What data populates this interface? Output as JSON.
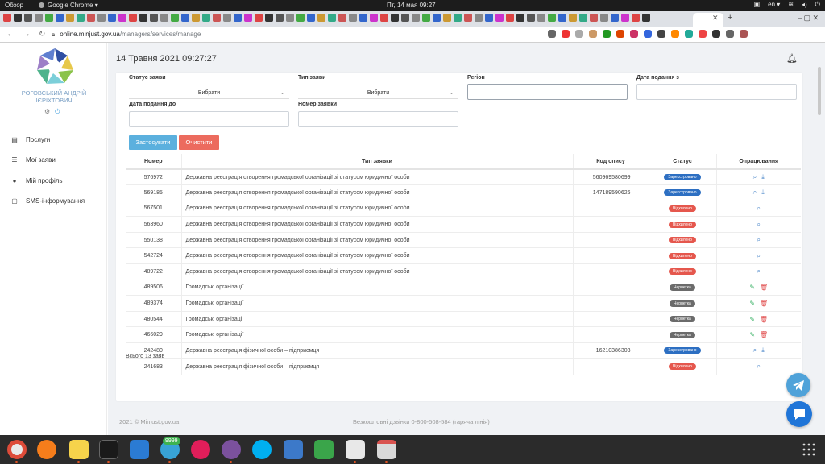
{
  "os_bar": {
    "overview": "Обзор",
    "app_name": "Google Chrome ▾",
    "clock": "Пт, 14 мая  09:27",
    "lang": "en ▾"
  },
  "browser": {
    "url_host": "online.minjust.gov.ua",
    "url_path": "/managers/services/manage"
  },
  "sidebar": {
    "user_name": "РОГОВСЬКИЙ АНДРІЙ ІЄРІХТОВИЧ",
    "items": [
      {
        "label": "Послуги",
        "icon": "document-icon"
      },
      {
        "label": "Мої заяви",
        "icon": "list-icon"
      },
      {
        "label": "Мій профіль",
        "icon": "user-icon"
      },
      {
        "label": "SMS-інформування",
        "icon": "chat-icon"
      }
    ]
  },
  "header": {
    "date": "14 Травня 2021 09:27:27"
  },
  "filters": {
    "status_label": "Статус заяви",
    "status_value": "Вибрати",
    "type_label": "Тип заяви",
    "type_value": "Вибрати",
    "region_label": "Регіон",
    "date_from_label": "Дата подання з",
    "date_to_label": "Дата подання до",
    "number_label": "Номер заявки",
    "apply_label": "Застосувати",
    "clear_label": "Очистити"
  },
  "table": {
    "headers": [
      "Номер",
      "Тип заявки",
      "Код опису",
      "Статус",
      "Опрацювання"
    ],
    "rows": [
      {
        "num": "576972",
        "type": "Державна реєстрація створення громадської організації зі статусом юридичної особи",
        "code": "560969580699",
        "status": "Зареєстровано",
        "kind": "reg"
      },
      {
        "num": "569185",
        "type": "Державна реєстрація створення громадської організації зі статусом юридичної особи",
        "code": "147189590626",
        "status": "Зареєстровано",
        "kind": "reg"
      },
      {
        "num": "567501",
        "type": "Державна реєстрація створення громадської організації зі статусом юридичної особи",
        "code": "",
        "status": "Відхилено",
        "kind": "rej"
      },
      {
        "num": "563960",
        "type": "Державна реєстрація створення громадської організації зі статусом юридичної особи",
        "code": "",
        "status": "Відхилено",
        "kind": "rej"
      },
      {
        "num": "550138",
        "type": "Державна реєстрація створення громадської організації зі статусом юридичної особи",
        "code": "",
        "status": "Відхилено",
        "kind": "rej"
      },
      {
        "num": "542724",
        "type": "Державна реєстрація створення громадської організації зі статусом юридичної особи",
        "code": "",
        "status": "Відхилено",
        "kind": "rej"
      },
      {
        "num": "489722",
        "type": "Державна реєстрація створення громадської організації зі статусом юридичної особи",
        "code": "",
        "status": "Відхилено",
        "kind": "rej"
      },
      {
        "num": "489506",
        "type": "Громадські організації",
        "code": "",
        "status": "Чернетка",
        "kind": "draft"
      },
      {
        "num": "489374",
        "type": "Громадські організації",
        "code": "",
        "status": "Чернетка",
        "kind": "draft"
      },
      {
        "num": "480544",
        "type": "Громадські організації",
        "code": "",
        "status": "Чернетка",
        "kind": "draft"
      },
      {
        "num": "466029",
        "type": "Громадські організації",
        "code": "",
        "status": "Чернетка",
        "kind": "draft"
      },
      {
        "num": "242480",
        "type": "Державна реєстрація фізичної особи – підприємця",
        "code": "16210386303",
        "status": "Зареєстровано",
        "kind": "reg"
      },
      {
        "num": "241683",
        "type": "Державна реєстрація фізичної особи – підприємця",
        "code": "",
        "status": "Відхилено",
        "kind": "rej"
      }
    ],
    "total": "Всього 13 заяв"
  },
  "status_colors": {
    "reg": "#2d6fc2",
    "rej": "#e5574d",
    "draft": "#6b6b6b"
  },
  "footer": {
    "copyright": "2021 © Minjust.gov.ua",
    "hotline": "Безкоштовні дзвінки 0-800-508-584 (гаряча лінія)"
  },
  "taskbar": {
    "badge": "9999"
  }
}
